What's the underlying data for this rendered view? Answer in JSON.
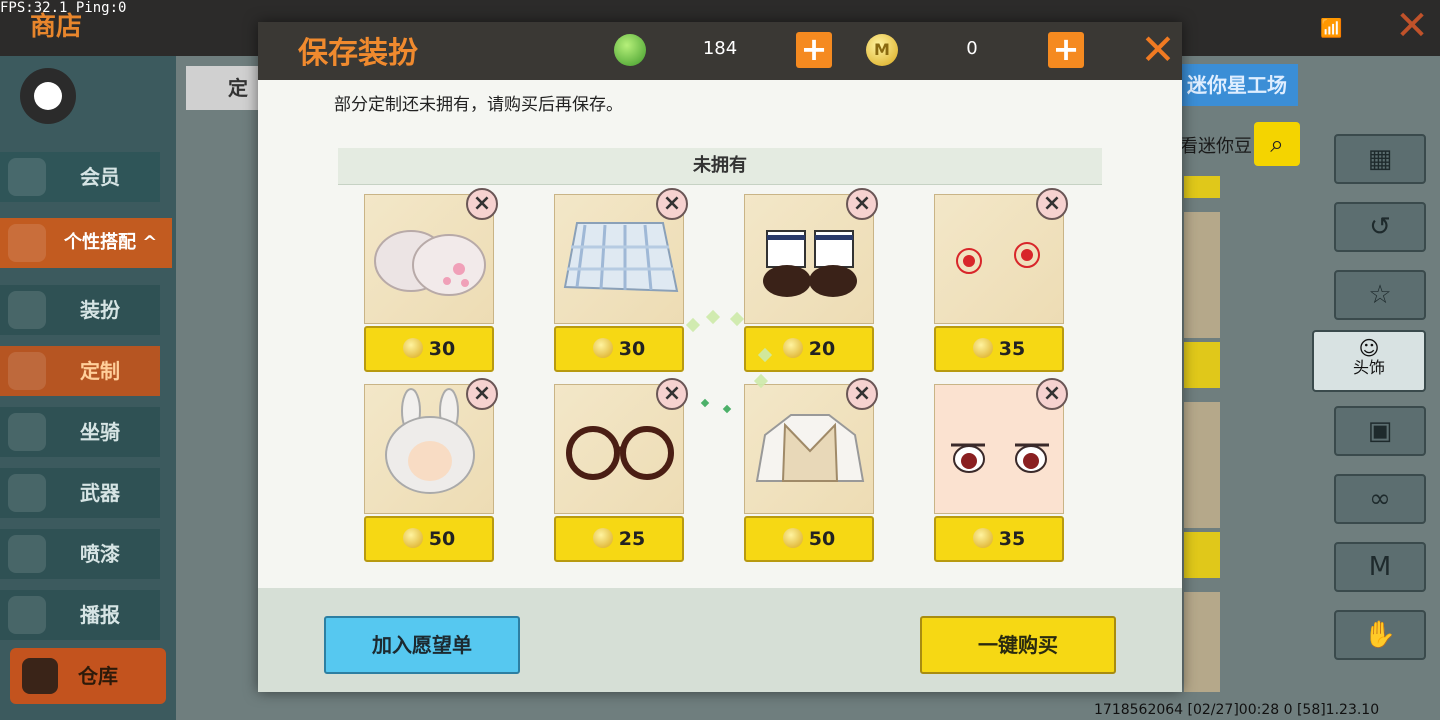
{
  "debug": {
    "fps": "FPS:32.1  Ping:0"
  },
  "background": {
    "shop_title": "商店",
    "tab_custom": "定",
    "workshop_label": "迷你星工场",
    "mini_bean_label": "看迷你豆",
    "sidebar": [
      {
        "label": "会员"
      },
      {
        "label": "个性搭配"
      },
      {
        "label": "装扮"
      },
      {
        "label": "定制"
      },
      {
        "label": "坐骑"
      },
      {
        "label": "武器"
      },
      {
        "label": "喷漆"
      },
      {
        "label": "播报"
      }
    ],
    "warehouse_label": "仓库",
    "right_tabs": [
      {
        "icon": "grid-icon"
      },
      {
        "icon": "history-icon"
      },
      {
        "icon": "outfit-icon"
      },
      {
        "label": "头饰",
        "icon": "head-icon"
      },
      {
        "icon": "face-icon"
      },
      {
        "icon": "mask-icon"
      },
      {
        "icon": "shirt-icon"
      },
      {
        "icon": "hand-icon"
      }
    ],
    "footer_ids": "1718562064    [02/27]00:28 0  [58]1.23.10"
  },
  "modal": {
    "title": "保存装扮",
    "gems": "184",
    "coins": "0",
    "notice": "部分定制还未拥有，请购买后再保存。",
    "section_label": "未拥有",
    "items": [
      {
        "name": "bunny-paw-gloves",
        "price": "30"
      },
      {
        "name": "plaid-skirt",
        "price": "30"
      },
      {
        "name": "black-shoes-socks",
        "price": "20"
      },
      {
        "name": "red-flower-accessory",
        "price": "35"
      },
      {
        "name": "bunny-ear-hair",
        "price": "50"
      },
      {
        "name": "round-glasses",
        "price": "25"
      },
      {
        "name": "sweater-vest-top",
        "price": "50"
      },
      {
        "name": "red-eyes-face",
        "price": "35"
      }
    ],
    "wishlist_button": "加入愿望单",
    "buy_all_button": "一键购买"
  }
}
